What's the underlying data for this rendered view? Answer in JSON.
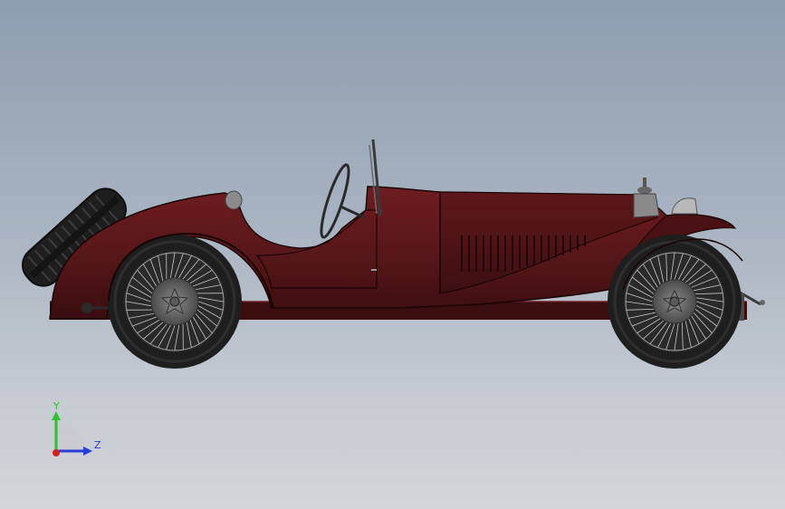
{
  "viewport": {
    "model": "vintage-roadster",
    "view_orientation": "right-side",
    "colors": {
      "background_top": "#8e9db0",
      "background_bottom": "#d3d5d9",
      "body": "#5a1618",
      "body_dark": "#3a0d0f",
      "tire": "#1e1e1e",
      "spoke": "#cfcfcf",
      "hub": "#6a6a6a",
      "chrome": "#9a9a9a"
    }
  },
  "triad": {
    "y_label": "Y",
    "z_label": "Z",
    "colors": {
      "y": "#2ec22e",
      "z": "#2b3bd8",
      "x": "#d42020"
    }
  }
}
